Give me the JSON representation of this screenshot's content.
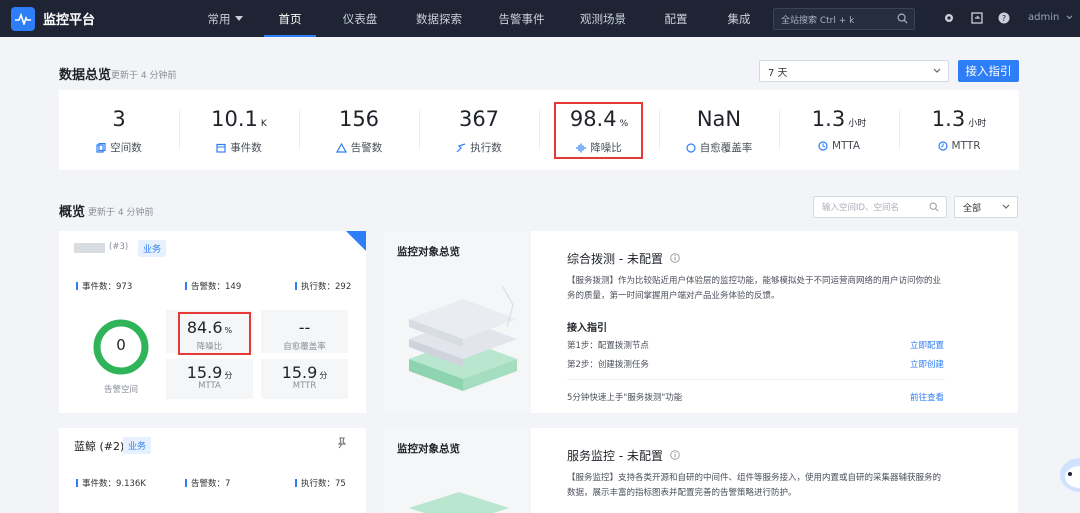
{
  "app": {
    "title": "监控平台"
  },
  "nav": {
    "items": [
      {
        "label": "常用",
        "has_dropdown": true
      },
      {
        "label": "首页",
        "active": true
      },
      {
        "label": "仪表盘"
      },
      {
        "label": "数据探索"
      },
      {
        "label": "告警事件"
      },
      {
        "label": "观测场景"
      },
      {
        "label": "配置"
      },
      {
        "label": "集成"
      }
    ]
  },
  "search": {
    "placeholder": "全站搜索 Ctrl + k"
  },
  "user": {
    "name": "admin"
  },
  "summary": {
    "title": "数据总览",
    "updated": "更新于 4 分钟前",
    "range_select": "7 天",
    "access_button": "接入指引",
    "stats": [
      {
        "value": "3",
        "unit": "",
        "label": "空间数",
        "icon": "space-icon"
      },
      {
        "value": "10.1",
        "unit": "K",
        "label": "事件数",
        "icon": "event-icon"
      },
      {
        "value": "156",
        "unit": "",
        "label": "告警数",
        "icon": "alert-icon"
      },
      {
        "value": "367",
        "unit": "",
        "label": "执行数",
        "icon": "execute-icon"
      },
      {
        "value": "98.4",
        "unit": "%",
        "label": "降噪比",
        "icon": "noise-reduction-icon",
        "highlighted": true
      },
      {
        "value": "NaN",
        "unit": "",
        "label": "自愈覆盖率",
        "icon": "self-heal-icon"
      },
      {
        "value": "1.3",
        "unit": "小时",
        "label": "MTTA",
        "icon": "mtta-icon"
      },
      {
        "value": "1.3",
        "unit": "小时",
        "label": "MTTR",
        "icon": "mttr-icon"
      }
    ]
  },
  "overview": {
    "title": "概览",
    "updated": "更新于 4 分钟前",
    "search_placeholder": "输入空间ID、空间名",
    "filter_select": "全部"
  },
  "spaces": [
    {
      "name": "(#3)",
      "tag": "业务",
      "events": "事件数：973",
      "alerts": "告警数：149",
      "executes": "执行数：292",
      "ring_value": "0",
      "ring_label": "告警空间",
      "ring_color": "#2fb45a",
      "noise": {
        "value": "84.6",
        "unit": "%",
        "label": "降噪比"
      },
      "self_heal": {
        "value": "--",
        "label": "自愈覆盖率"
      },
      "mtta": {
        "value": "15.9",
        "unit": "分",
        "label": "MTTA"
      },
      "mttr": {
        "value": "15.9",
        "unit": "分",
        "label": "MTTR"
      },
      "overview_title": "监控对象总览",
      "config_title": "综合拨测 - 未配置",
      "config_desc_1": "【服务拨测】作为比较贴近用户体验层的监控功能，能够模拟处于不同运营商网络的用户访问你的业",
      "config_desc_2": "务的质量，第一时间掌握用户端对产品业务体验的反馈。",
      "guide_title": "接入指引",
      "step1": "第1步：配置拨测节点",
      "step1_link": "立即配置",
      "step2": "第2步：创建拨测任务",
      "step2_link": "立即创建",
      "quick": "5分钟快速上手\"服务拨测\"功能",
      "quick_link": "前往查看"
    },
    {
      "name": "蓝鲸 (#2)",
      "tag": "业务",
      "events": "事件数：9.136K",
      "alerts": "告警数：7",
      "executes": "执行数：75",
      "overview_title": "监控对象总览",
      "config_title": "服务监控 - 未配置",
      "config_desc_1": "【服务监控】支持各类开源和自研的中间件、组件等服务接入，使用内置或自研的采集器辅获服务的",
      "config_desc_2": "数据，展示丰富的指标图表并配置完善的告警策略进行防护。"
    }
  ]
}
